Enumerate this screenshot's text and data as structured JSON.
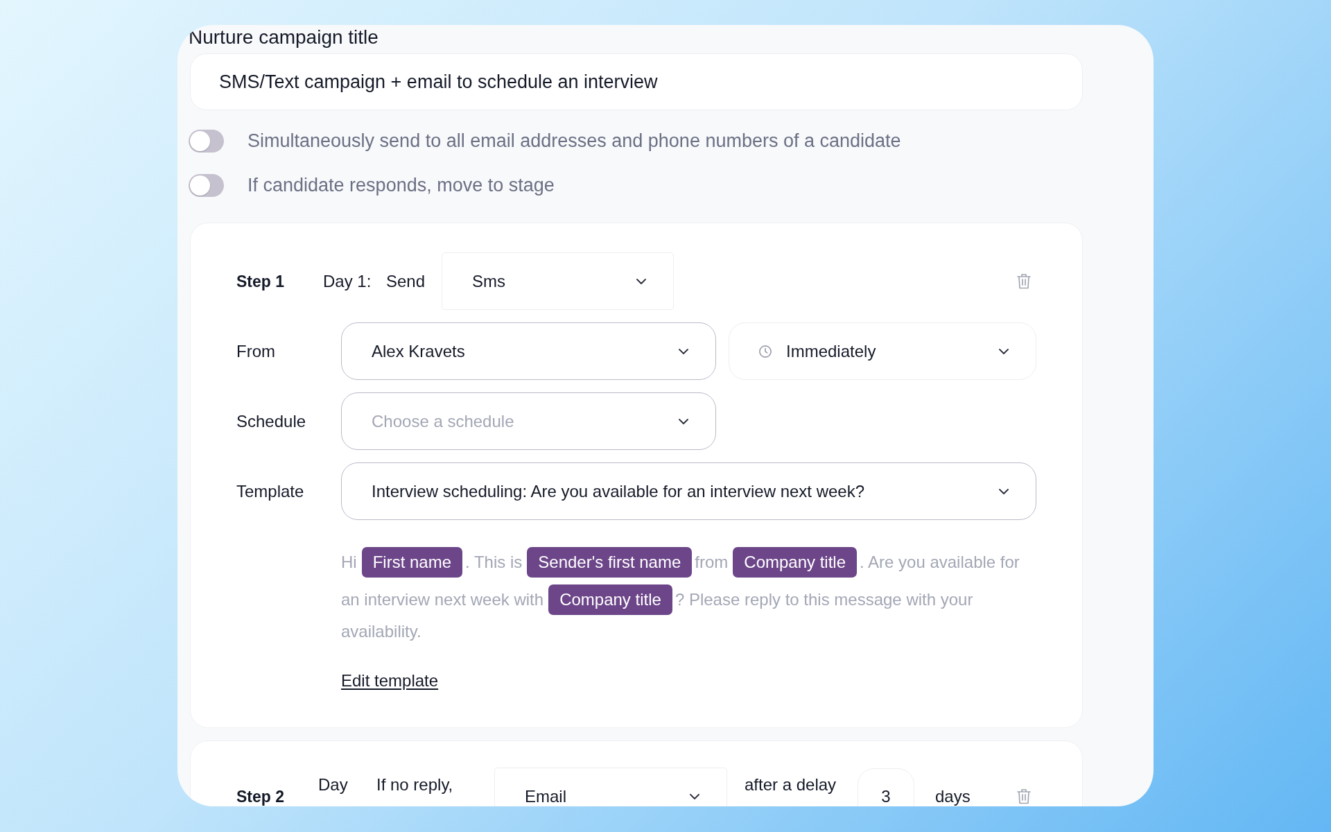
{
  "campaign_title": {
    "label": "Nurture campaign title",
    "value": "SMS/Text campaign + email to schedule an interview"
  },
  "toggles": [
    {
      "label": "Simultaneously send to all email addresses and phone numbers of a candidate",
      "on": false
    },
    {
      "label": "If candidate responds, move to stage",
      "on": false
    }
  ],
  "steps": [
    {
      "kind": "message",
      "title": "Step 1",
      "day": "Day 1:",
      "action": "Send",
      "channel": "Sms",
      "from": {
        "label": "From",
        "value": "Alex Kravets",
        "timing": "Immediately"
      },
      "schedule": {
        "label": "Schedule",
        "placeholder": "Choose a schedule"
      },
      "template": {
        "label": "Template",
        "value": "Interview scheduling: Are you available for an interview next week?",
        "preview_lines": [
          [
            {
              "kind": "text",
              "text": "Hi"
            },
            {
              "kind": "variable",
              "text": "First name"
            },
            {
              "kind": "text",
              "text": ". This is"
            },
            {
              "kind": "variable",
              "text": "Sender's first name"
            },
            {
              "kind": "text",
              "text": "from"
            },
            {
              "kind": "variable",
              "text": "Company title"
            },
            {
              "kind": "text",
              "text": ". Are you available for"
            }
          ],
          [
            {
              "kind": "text",
              "text": "an interview next week with"
            },
            {
              "kind": "variable",
              "text": "Company title"
            },
            {
              "kind": "text",
              "text": "? Please reply to this message with your"
            }
          ],
          [
            {
              "kind": "text",
              "text": "availability."
            }
          ]
        ],
        "edit_link": "Edit template"
      }
    },
    {
      "kind": "follow_up",
      "title": "Step 2",
      "day": "Day",
      "condition": "If no reply,",
      "channel": "Email",
      "delay_label": "after a delay",
      "delay_value": "3",
      "delay_unit": "days"
    }
  ]
}
